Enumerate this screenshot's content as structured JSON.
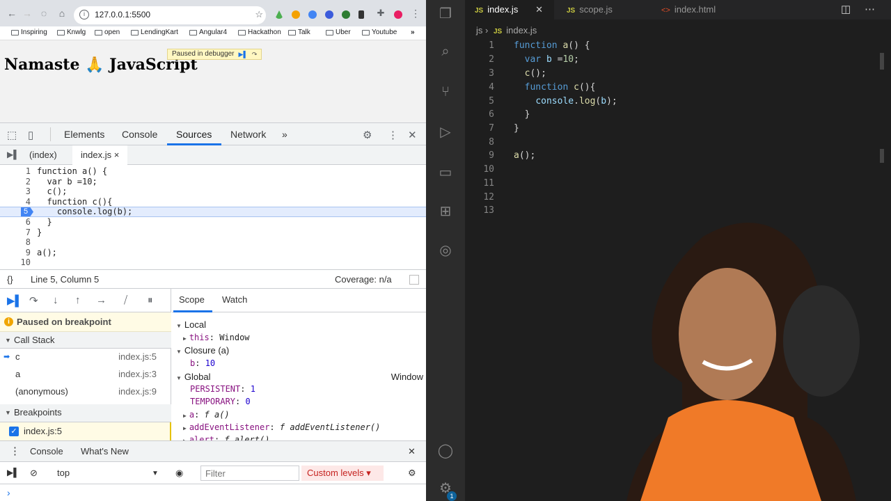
{
  "browser": {
    "url": "127.0.0.1:5500",
    "bookmarks": [
      "Inspiring",
      "Knwlg",
      "open",
      "LendingKart",
      "Angular4",
      "Hackathon",
      "Talk",
      "Uber",
      "Youtube"
    ],
    "more_bookmarks": "»",
    "page_title": "Namaste 🙏 JavaScript",
    "paused_badge": "Paused in debugger"
  },
  "devtools": {
    "tabs": [
      "Elements",
      "Console",
      "Sources",
      "Network"
    ],
    "tabs_more": "»",
    "source_tabs": [
      "(index)",
      "index.js"
    ],
    "close_tab": "×",
    "code_lines": [
      {
        "n": "1",
        "text": "function a() {"
      },
      {
        "n": "2",
        "text": "  var b =10;"
      },
      {
        "n": "3",
        "text": "  c();"
      },
      {
        "n": "4",
        "text": "  function c(){"
      },
      {
        "n": "5",
        "text": "    console.log(b);"
      },
      {
        "n": "6",
        "text": "  }"
      },
      {
        "n": "7",
        "text": "}"
      },
      {
        "n": "8",
        "text": ""
      },
      {
        "n": "9",
        "text": "a();"
      },
      {
        "n": "10",
        "text": ""
      }
    ],
    "status_braces": "{}",
    "cursor_position": "Line 5, Column 5",
    "coverage": "Coverage: n/a",
    "paused_message": "Paused on breakpoint",
    "call_stack_label": "Call Stack",
    "call_stack": [
      {
        "fn": "c",
        "loc": "index.js:5"
      },
      {
        "fn": "a",
        "loc": "index.js:3"
      },
      {
        "fn": "(anonymous)",
        "loc": "index.js:9"
      }
    ],
    "breakpoints_label": "Breakpoints",
    "breakpoint_item": "index.js:5",
    "scope_tab": "Scope",
    "watch_tab": "Watch",
    "scope": {
      "local": "Local",
      "this_key": "this",
      "this_val": "Window",
      "closure": "Closure (a)",
      "b_key": "b",
      "b_val": "10",
      "global": "Global",
      "global_val": "Window",
      "persistent_key": "PERSISTENT",
      "persistent_val": "1",
      "temporary_key": "TEMPORARY",
      "temporary_val": "0",
      "a_key": "a",
      "a_val": "f a()",
      "ael_key": "addEventListener",
      "ael_val": "f addEventListener()",
      "alert_key": "alert",
      "alert_val": "f alert()"
    },
    "drawer_tabs": [
      "Console",
      "What's New"
    ],
    "context": "top",
    "filter_placeholder": "Filter",
    "custom_levels": "Custom levels ▾",
    "prompt": "›"
  },
  "vscode": {
    "tabs": [
      {
        "badge": "JS",
        "label": "index.js"
      },
      {
        "badge": "JS",
        "label": "scope.js"
      },
      {
        "badge": "<>",
        "label": "index.html"
      }
    ],
    "breadcrumb_folder": "js",
    "breadcrumb_sep": "›",
    "breadcrumb_badge": "JS",
    "breadcrumb_file": "index.js",
    "line_numbers": [
      "1",
      "2",
      "3",
      "4",
      "5",
      "6",
      "7",
      "8",
      "9",
      "10",
      "11",
      "12",
      "13"
    ],
    "settings_badge": "1"
  },
  "colors": {
    "devtools_accent": "#1a73e8",
    "vscode_bg": "#1e1e1e",
    "keyword": "#569cd6",
    "function": "#dcdcaa"
  }
}
